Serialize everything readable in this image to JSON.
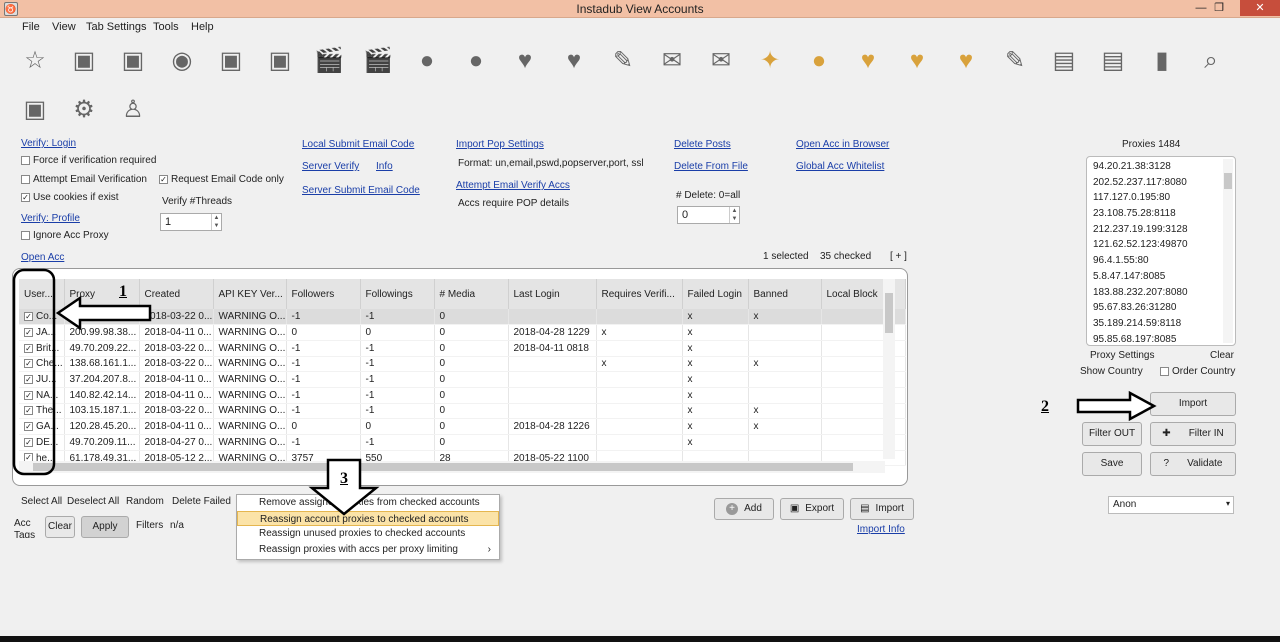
{
  "window": {
    "title": "Instadub  View Accounts",
    "app_icon": "app-icon",
    "minimize": "—",
    "maximize": "❐",
    "close": "✕"
  },
  "menu": [
    "File",
    "View",
    "Tab Settings",
    "Tools",
    "Help"
  ],
  "toolbar_icons": [
    "star-icon",
    "profile-photo-icon",
    "profile-photo-multi-icon",
    "eye-icon",
    "photo-settings-icon",
    "photo-scheduler-icon",
    "clapperboard-icon",
    "clapperboard-heart-icon",
    "user-silhouette-icon",
    "user-add-icon",
    "heart-icon",
    "heart-x-icon",
    "comment-icon",
    "envelope-open-icon",
    "envelope-download-icon",
    "like-burst-icon",
    "user-mass-icon",
    "heart-mass-icon",
    "mass-comment-icon",
    "heart-mass-x-icon",
    "mass-text-icon",
    "table-icon",
    "table-upload-icon",
    "bar-chart-icon",
    "magnify-icon",
    "search-photo-icon",
    "gear-cluster-icon",
    "user-lock-icon"
  ],
  "left_options": {
    "verify_login": "Verify: Login",
    "force_verification": "Force if verification required",
    "attempt_email_verification": "Attempt Email Verification",
    "use_cookies": "Use cookies if exist",
    "verify_profile": "Verify: Profile",
    "ignore_proxy": "Ignore Acc Proxy",
    "request_email_code": "Request Email Code only",
    "verify_threads_label": "Verify #Threads",
    "verify_threads_value": "1",
    "open_acc": "Open Acc"
  },
  "middle_links": {
    "local_submit_email": "Local Submit Email Code",
    "server_verify": "Server Verify",
    "info": "Info",
    "server_submit_email": "Server Submit Email Code",
    "import_pop": "Import Pop Settings",
    "format": "Format: un,email,pswd,popserver,port, ssl",
    "attempt_email_verify_accs": "Attempt Email Verify Accs",
    "accs_require_pop": "Accs require POP details",
    "delete_posts": "Delete Posts",
    "delete_from_file": "Delete From File",
    "delete_label": "# Delete: 0=all",
    "delete_value": "0",
    "open_acc_browser": "Open Acc in Browser",
    "global_whitelist": "Global Acc Whitelist"
  },
  "status": {
    "selected": "1 selected",
    "checked": "35 checked",
    "expand": "[ + ]"
  },
  "grid": {
    "columns": [
      "User...",
      "Proxy",
      "Created",
      "API KEY Ver...",
      "Followers",
      "Followings",
      "# Media",
      "Last Login",
      "Requires Verifi...",
      "Failed Login",
      "Banned",
      "Local Block"
    ],
    "rows": [
      [
        "Co...",
        "198.204.239...",
        "2018-03-22 0...",
        "WARNING O...",
        "-1",
        "-1",
        "0",
        "",
        "",
        "x",
        "x",
        ""
      ],
      [
        "JA...",
        "200.99.98.38...",
        "2018-04-11 0...",
        "WARNING O...",
        "0",
        "0",
        "0",
        "2018-04-28 1229",
        "x",
        "x",
        "",
        ""
      ],
      [
        "Brit...",
        "49.70.209.22...",
        "2018-03-22 0...",
        "WARNING O...",
        "-1",
        "-1",
        "0",
        "2018-04-11 0818",
        "",
        "x",
        "",
        ""
      ],
      [
        "Che...",
        "138.68.161.1...",
        "2018-03-22 0...",
        "WARNING O...",
        "-1",
        "-1",
        "0",
        "",
        "x",
        "x",
        "x",
        ""
      ],
      [
        "JU...",
        "37.204.207.8...",
        "2018-04-11 0...",
        "WARNING O...",
        "-1",
        "-1",
        "0",
        "",
        "",
        "x",
        "",
        ""
      ],
      [
        "NA...",
        "140.82.42.14...",
        "2018-04-11 0...",
        "WARNING O...",
        "-1",
        "-1",
        "0",
        "",
        "",
        "x",
        "",
        ""
      ],
      [
        "The...",
        "103.15.187.1...",
        "2018-03-22 0...",
        "WARNING O...",
        "-1",
        "-1",
        "0",
        "",
        "",
        "x",
        "x",
        ""
      ],
      [
        "GA...",
        "120.28.45.20...",
        "2018-04-11 0...",
        "WARNING O...",
        "0",
        "0",
        "0",
        "2018-04-28 1226",
        "",
        "x",
        "x",
        ""
      ],
      [
        "DE...",
        "49.70.209.11...",
        "2018-04-27 0...",
        "WARNING O...",
        "-1",
        "-1",
        "0",
        "",
        "",
        "x",
        "",
        ""
      ],
      [
        "he...",
        "61.178.49.31...",
        "2018-05-12 2...",
        "WARNING O...",
        "3757",
        "550",
        "28",
        "2018-05-22 1100",
        "",
        "",
        "",
        ""
      ]
    ]
  },
  "bottom_actions": {
    "select_all": "Select All",
    "deselect_all": "Deselect All",
    "random": "Random",
    "delete_failed": "Delete Failed",
    "acc_tags": "Acc Tags",
    "clear": "Clear",
    "apply": "Apply",
    "filters": "Filters",
    "filters_value": "n/a"
  },
  "context_menu": [
    "Remove assigned proxies from checked accounts",
    "Reassign account proxies to checked accounts",
    "Reassign unused proxies to checked accounts",
    "Reassign proxies with accs per proxy limiting"
  ],
  "center_buttons": {
    "add": "Add",
    "export": "Export",
    "import": "Import",
    "import_info": "Import Info"
  },
  "proxies": {
    "title": "Proxies 1484",
    "list": [
      "94.20.21.38:3128",
      "202.52.237.117:8080",
      "117.127.0.195:80",
      "23.108.75.28:8118",
      "212.237.19.199:3128",
      "121.62.52.123:49870",
      "96.4.1.55:80",
      "5.8.47.147:8085",
      "183.88.232.207:8080",
      "95.67.83.26:31280",
      "35.189.214.59:8118",
      "95.85.68.197:8085"
    ],
    "settings": "Proxy Settings",
    "clear": "Clear",
    "show_country": "Show Country",
    "order_country": "Order Country",
    "import": "Import",
    "filter_out": "Filter OUT",
    "filter_in": "Filter IN",
    "save": "Save",
    "validate": "Validate",
    "anon_select": "Anon"
  },
  "annotations": {
    "one": "1",
    "two": "2",
    "three": "3"
  }
}
